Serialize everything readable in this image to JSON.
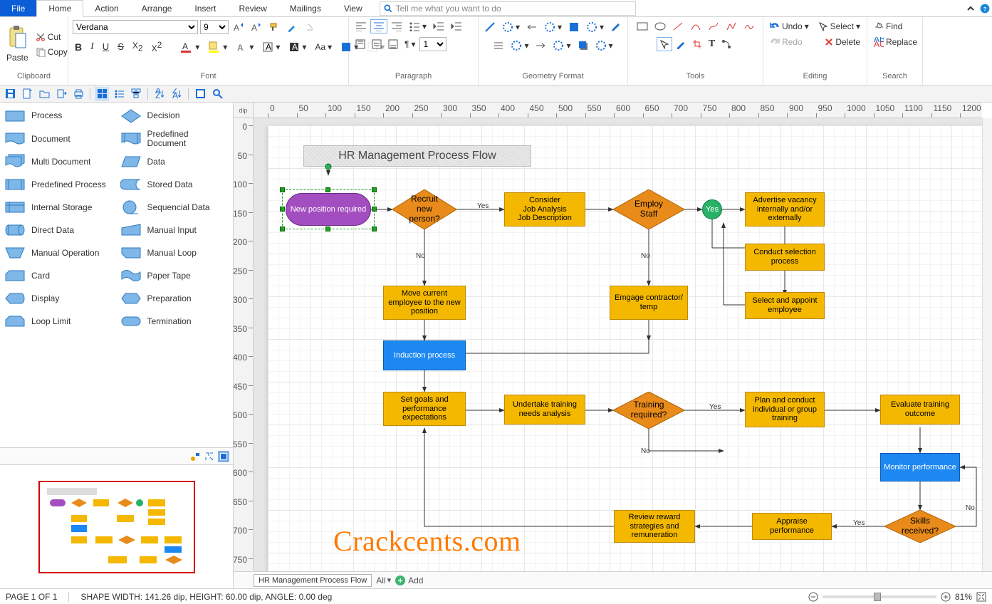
{
  "menubar": {
    "tabs": [
      "File",
      "Home",
      "Action",
      "Arrange",
      "Insert",
      "Review",
      "Mailings",
      "View"
    ],
    "search_placeholder": "Tell me what you want to do"
  },
  "ribbon": {
    "clipboard": {
      "label": "Clipboard",
      "paste": "Paste",
      "cut": "Cut",
      "copy": "Copy"
    },
    "font": {
      "label": "Font",
      "family": "Verdana",
      "size": "9"
    },
    "paragraph": {
      "label": "Paragraph",
      "line_value": "1"
    },
    "geometry": {
      "label": "Geometry Format"
    },
    "tools": {
      "label": "Tools"
    },
    "editing": {
      "label": "Editing",
      "undo": "Undo",
      "redo": "Redo",
      "select": "Select",
      "delete": "Delete"
    },
    "search": {
      "label": "Search",
      "find": "Find",
      "replace": "Replace"
    }
  },
  "ruler_unit": "dip",
  "shapes_lib": [
    [
      "Process",
      "Decision"
    ],
    [
      "Document",
      "Predefined Document"
    ],
    [
      "Multi Document",
      "Data"
    ],
    [
      "Predefined Process",
      "Stored Data"
    ],
    [
      "Internal Storage",
      "Sequencial Data"
    ],
    [
      "Direct Data",
      "Manual Input"
    ],
    [
      "Manual Operation",
      "Manual Loop"
    ],
    [
      "Card",
      "Paper Tape"
    ],
    [
      "Display",
      "Preparation"
    ],
    [
      "Loop Limit",
      "Termination"
    ]
  ],
  "doc_tab": "HR Management Process Flow",
  "all_label": "All",
  "add_label": "Add",
  "status": {
    "page": "PAGE 1 OF 1",
    "shape": "SHAPE WIDTH: 141.26 dip, HEIGHT: 60.00 dip, ANGLE: 0.00 deg",
    "zoom": "81%"
  },
  "flow": {
    "title": "HR Management Process Flow",
    "nodes": {
      "n1": "New position required",
      "n2": "Recruit new person?",
      "n3": "Consider\nJob Analysis\nJob Description",
      "n4": "Employ Staff",
      "n5": "Yes",
      "n6": "Advertise vacancy internally and/or externally",
      "n7": "Conduct selection process",
      "n8": "Select and appoint employee",
      "n9": "Move current employee to the new position",
      "n10": "Emgage contractor/ temp",
      "n11": "Induction process",
      "n12": "Set goals and performance expectations",
      "n13": "Undertake training needs analysis",
      "n14": "Training required?",
      "n15": "Plan and conduct individual or group training",
      "n16": "Evaluate training outcome",
      "n17": "Monitor performance",
      "n18": "Skills received?",
      "n19": "Appraise performance",
      "n20": "Review reward strategies and remuneration"
    },
    "edge_labels": {
      "yes": "Yes",
      "no": "No"
    }
  },
  "watermark": "Crackcents.com"
}
